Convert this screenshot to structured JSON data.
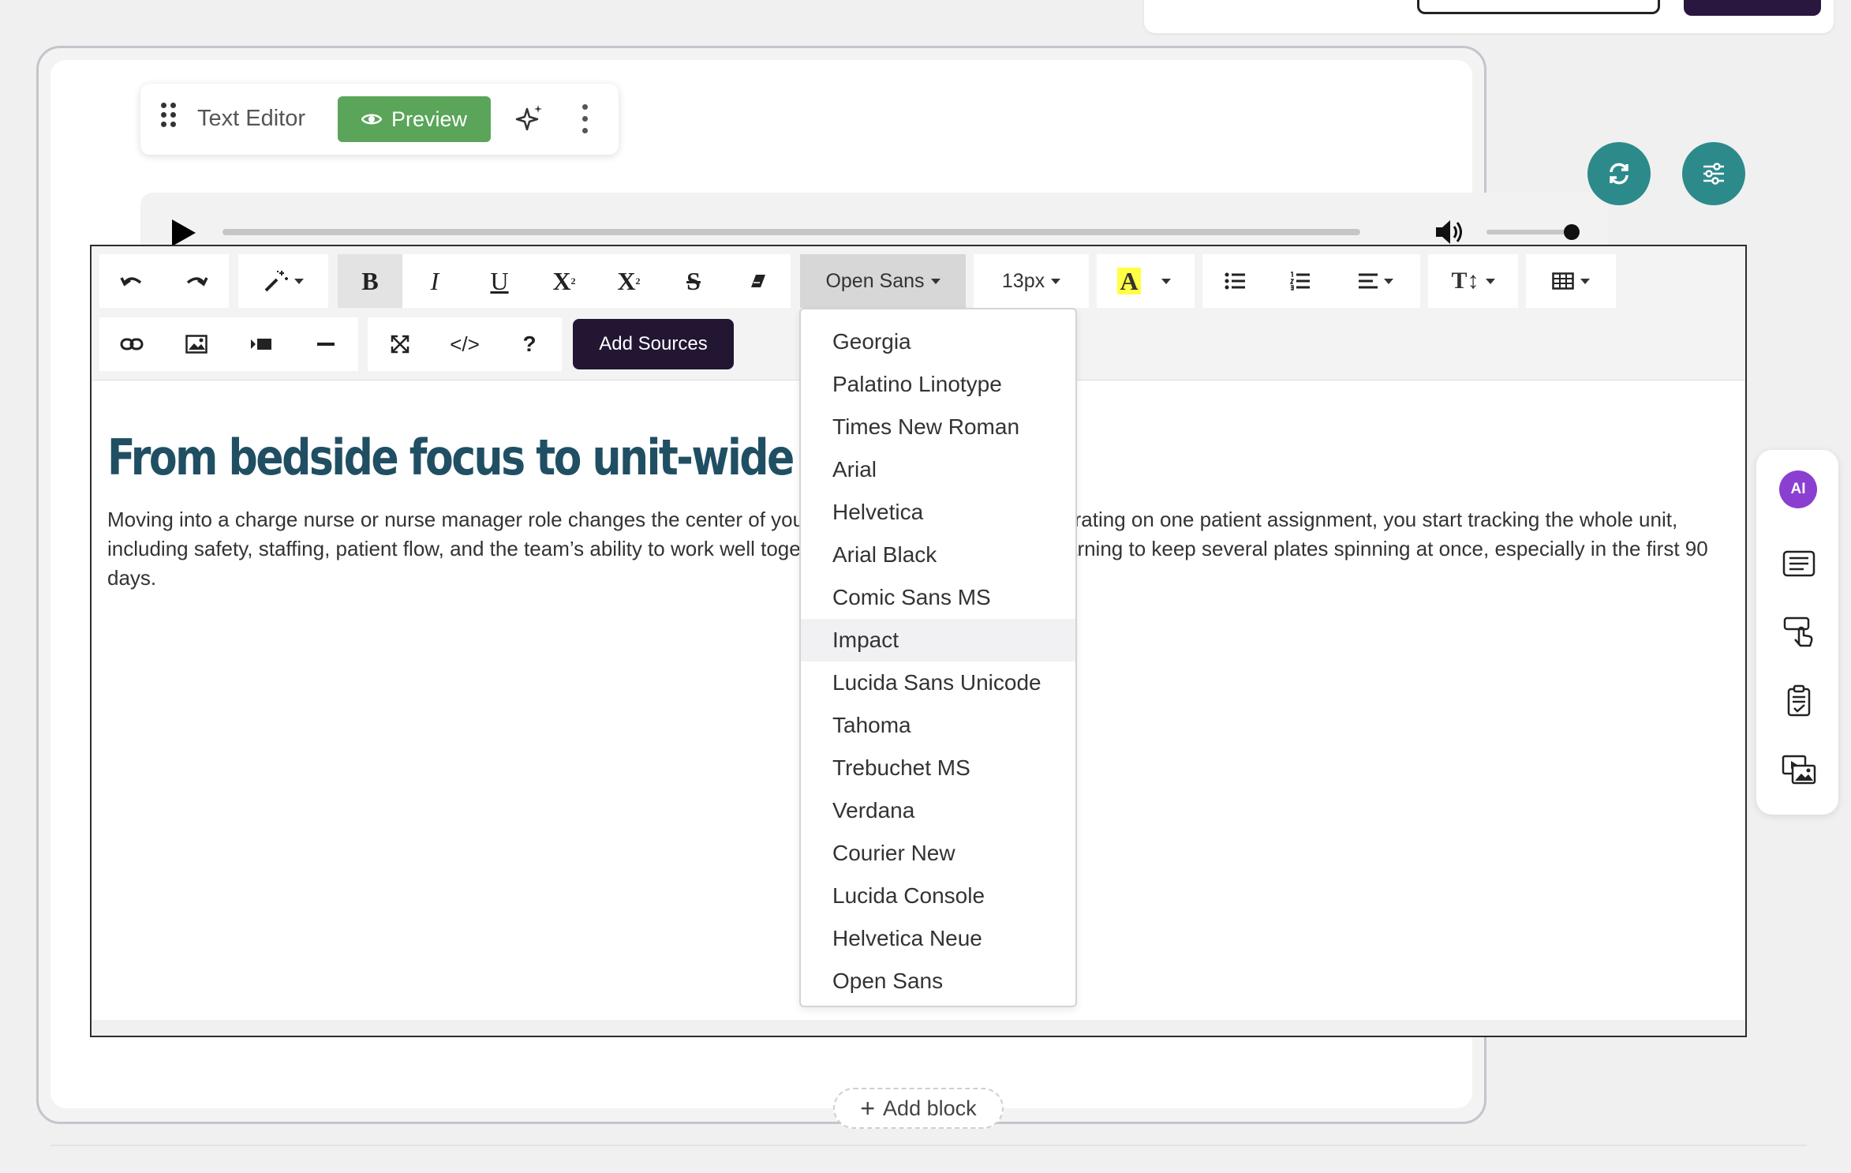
{
  "block": {
    "title": "Text Editor",
    "preview_label": "Preview"
  },
  "audio": {
    "progress": 0,
    "volume": 0.9
  },
  "toolbar": {
    "font_family": "Open Sans",
    "font_size": "13px",
    "add_sources_label": "Add Sources"
  },
  "content": {
    "heading": "From bedside focus to unit-wide fo",
    "body": "Moving into a charge nurse or nurse manager role changes the center of your attention. Instead of concentrating on one patient assignment, you start tracking the whole unit, including safety, staffing, patient flow, and the team’s ability to work well together. That shift can feel like learning to keep several plates spinning at once, especially in the first 90 days."
  },
  "font_menu": {
    "items": [
      "Georgia",
      "Palatino Linotype",
      "Times New Roman",
      "Arial",
      "Helvetica",
      "Arial Black",
      "Comic Sans MS",
      "Impact",
      "Lucida Sans Unicode",
      "Tahoma",
      "Trebuchet MS",
      "Verdana",
      "Courier New",
      "Lucida Console",
      "Helvetica Neue",
      "Open Sans"
    ],
    "hovered": "Impact"
  },
  "side_panel": {
    "ai_label": "AI"
  },
  "add_block_label": "Add block",
  "colors": {
    "accent_teal": "#2d8a8a",
    "preview_green": "#5aa55a",
    "dark_purple": "#221633",
    "heading_blue": "#204f63",
    "ai_purple": "#8a3fd1"
  }
}
